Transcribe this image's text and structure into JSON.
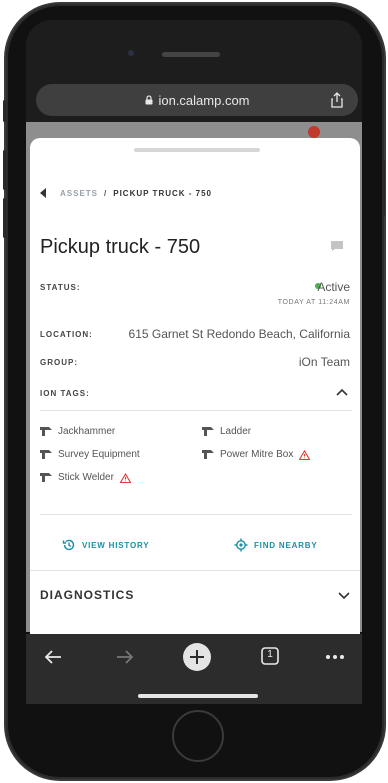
{
  "browser": {
    "url": "ion.calamp.com",
    "tabs_count": "1"
  },
  "breadcrumb": {
    "parent": "ASSETS",
    "separator": "/",
    "current": "PICKUP TRUCK - 750"
  },
  "asset": {
    "title": "Pickup truck - 750",
    "status_label": "STATUS:",
    "status_value": "Active",
    "status_time": "TODAY AT 11:24AM",
    "location_label": "LOCATION:",
    "location_value": "615 Garnet St Redondo Beach, California",
    "group_label": "GROUP:",
    "group_value": "iOn Team",
    "tags_label": "ION TAGS:"
  },
  "tags": [
    {
      "name": "Jackhammer",
      "warning": false
    },
    {
      "name": "Ladder",
      "warning": false
    },
    {
      "name": "Survey Equipment",
      "warning": false
    },
    {
      "name": "Power Mitre Box",
      "warning": true
    },
    {
      "name": "Stick Welder",
      "warning": true
    }
  ],
  "actions": {
    "history": "VIEW HISTORY",
    "nearby": "FIND NEARBY"
  },
  "sections": {
    "diagnostics": "DIAGNOSTICS"
  },
  "colors": {
    "accent": "#1b8fa5",
    "status_active": "#4caf50",
    "warning": "#e53935"
  }
}
